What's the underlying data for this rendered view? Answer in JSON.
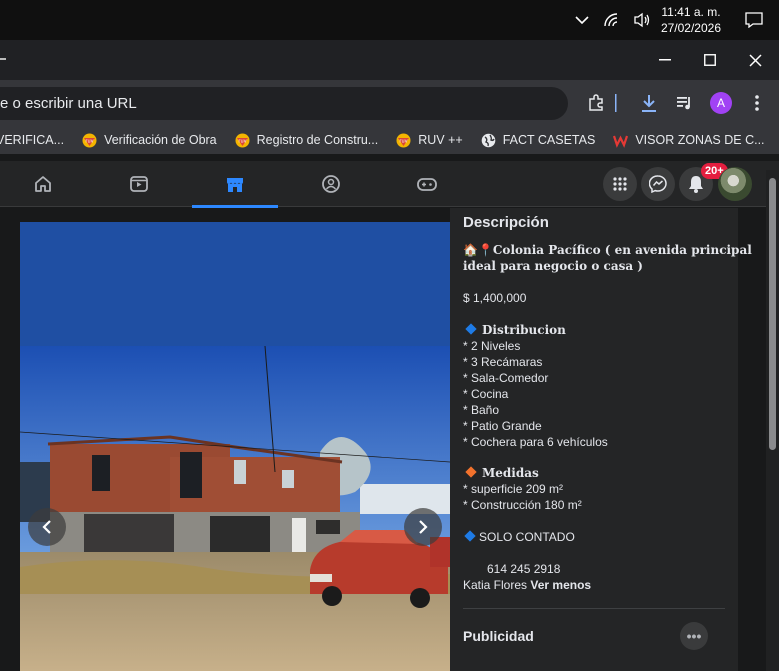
{
  "taskbar": {
    "time": "11:41 a. m.",
    "date": "27/02/2026",
    "icons": [
      "chevron-up-icon",
      "wifi-icon",
      "volume-icon",
      "notification-icon"
    ]
  },
  "browser": {
    "omnibox_text": "e o escribir una URL",
    "profile_initial": "A",
    "bookmarks": [
      {
        "label": "VERIFICA...",
        "icon": "orange"
      },
      {
        "label": "Verificación de Obra",
        "icon": "ruv"
      },
      {
        "label": "Registro de Constru...",
        "icon": "ruv"
      },
      {
        "label": "RUV ++",
        "icon": "ruv"
      },
      {
        "label": "FACT CASETAS",
        "icon": "globe"
      },
      {
        "label": "VISOR ZONAS DE C...",
        "icon": "red"
      }
    ],
    "bookmarks_overflow": "»"
  },
  "facebook": {
    "notification_count": "20+",
    "accent_color": "#2d88ff",
    "badge_color": "#e41e3f"
  },
  "listing": {
    "section_title": "Descripción",
    "headline_line1": "🏠📍Colonia Pacífico ( en avenida principal",
    "headline_line2": "ideal para negocio o casa )",
    "price": "$ 1,400,000",
    "distribution_title": "Distribucion",
    "distribution_items": [
      "* 2 Niveles",
      "* 3 Recámaras",
      "* Sala-Comedor",
      "* Cocina",
      "* Baño",
      "* Patio Grande",
      "* Cochera para 6 vehículos"
    ],
    "measures_title": "Medidas",
    "measures_items": [
      "* superficie  209 m²",
      "* Construcción  180 m²"
    ],
    "payment": "SOLO CONTADO",
    "phone": "614 245 2918",
    "contact_name": "Katia Flores",
    "see_less": "Ver menos",
    "ads_title": "Publicidad",
    "more_label": "•••"
  }
}
